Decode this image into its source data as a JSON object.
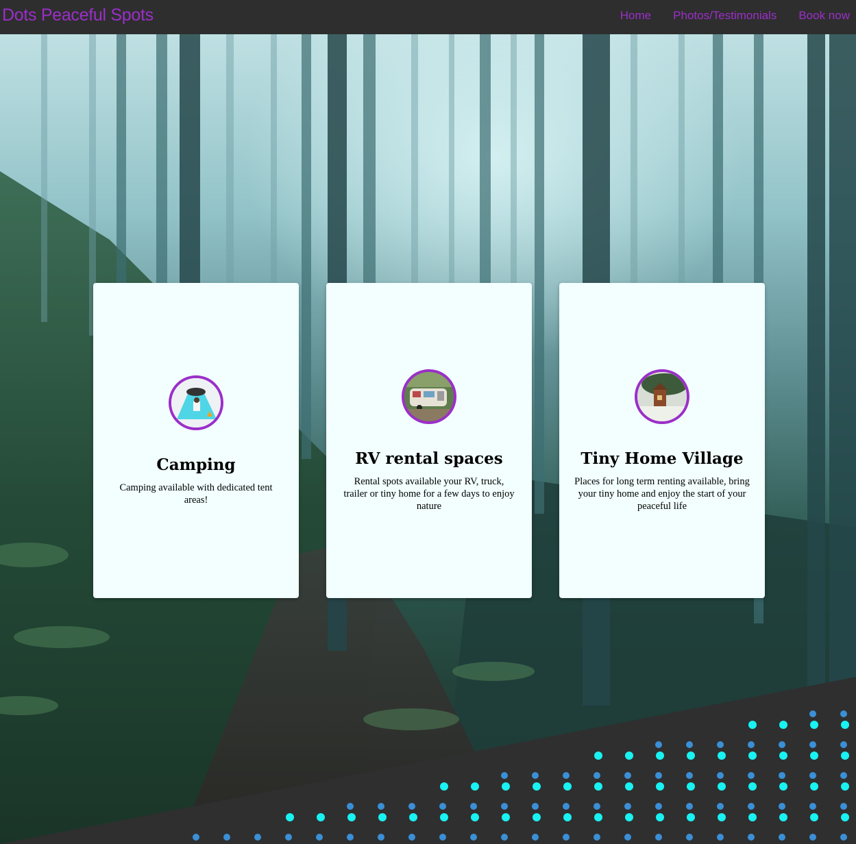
{
  "brand": {
    "name": "Dots Peaceful Spots"
  },
  "nav": {
    "links": [
      {
        "label": "Home"
      },
      {
        "label": "Photos/Testimonials"
      },
      {
        "label": "Book now"
      }
    ]
  },
  "cards": [
    {
      "icon": "camping-tent-photo",
      "title": "Camping",
      "text": "Camping available with dedicated tent areas!"
    },
    {
      "icon": "rv-trailer-photo",
      "title": "RV rental spaces",
      "text": "Rental spots available your RV, truck, trailer or tiny home for a few days to enjoy nature"
    },
    {
      "icon": "tiny-home-photo",
      "title": "Tiny Home Village",
      "text": "Places for long term renting available, bring your tiny home and enjoy the start of your peaceful life"
    }
  ],
  "colors": {
    "accent": "#9b2fc9",
    "navbar": "#2e2e2e",
    "card": "#f2fffe",
    "dot_cyan": "#19f2f2",
    "dot_blue": "#3b8fd6"
  }
}
